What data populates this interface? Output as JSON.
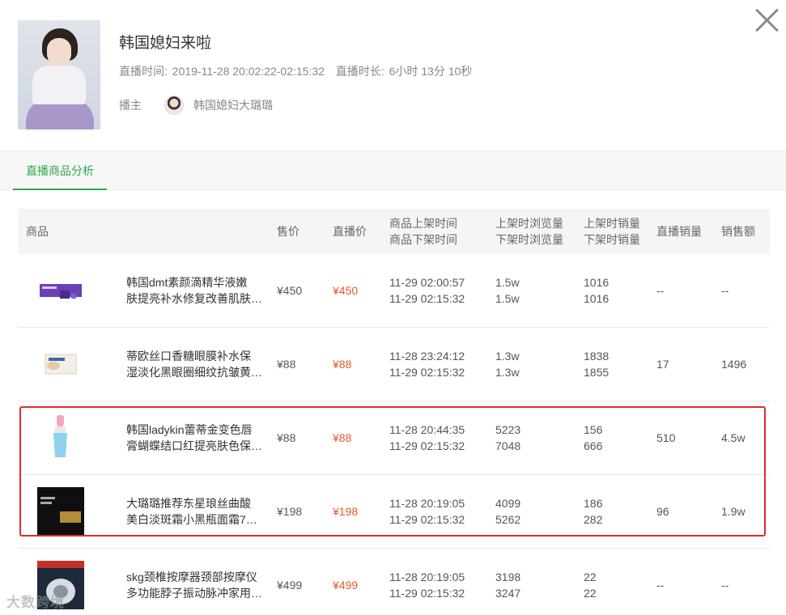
{
  "header": {
    "title": "韩国媳妇来啦",
    "live_time_label": "直播时间:",
    "live_time_value": "2019-11-28 20:02:22-02:15:32",
    "duration_label": "直播时长:",
    "duration_value": "6小时 13分 10秒",
    "anchor_label": "播主",
    "anchor_name": "韩国媳妇大璐璐"
  },
  "tabs": [
    {
      "label": "直播商品分析"
    }
  ],
  "table": {
    "headers": {
      "product": "商品",
      "price": "售价",
      "live_price": "直播价",
      "shelf_on": "商品上架时间",
      "shelf_off": "商品下架时间",
      "views_on": "上架时浏览量",
      "views_off": "下架时浏览量",
      "sales_on": "上架时销量",
      "sales_off": "下架时销量",
      "live_sales": "直播销量",
      "revenue": "销售额"
    },
    "rows": [
      {
        "name1": "韩国dmt素颜滴精华液嫩",
        "name2": "肤提亮补水修复改善肌肤…",
        "price": "¥450",
        "live_price": "¥450",
        "on_time": "11-29 02:00:57",
        "off_time": "11-29 02:15:32",
        "views_on": "1.5w",
        "views_off": "1.5w",
        "sales_on": "1016",
        "sales_off": "1016",
        "live_sales": "--",
        "revenue": "--"
      },
      {
        "name1": "蒂欧丝口香糖眼膜补水保",
        "name2": "湿淡化黑眼圈细纹抗皱黄…",
        "price": "¥88",
        "live_price": "¥88",
        "on_time": "11-28 23:24:12",
        "off_time": "11-29 02:15:32",
        "views_on": "1.3w",
        "views_off": "1.3w",
        "sales_on": "1838",
        "sales_off": "1855",
        "live_sales": "17",
        "revenue": "1496"
      },
      {
        "name1": "韩国ladykin蕾蒂金变色唇",
        "name2": "膏蝴蝶结口红提亮肤色保…",
        "price": "¥88",
        "live_price": "¥88",
        "on_time": "11-28 20:44:35",
        "off_time": "11-29 02:15:32",
        "views_on": "5223",
        "views_off": "7048",
        "sales_on": "156",
        "sales_off": "666",
        "live_sales": "510",
        "revenue": "4.5w"
      },
      {
        "name1": "大璐璐推荐东星琅丝曲酸",
        "name2": "美白淡斑霜小黑瓶面霜7…",
        "price": "¥198",
        "live_price": "¥198",
        "on_time": "11-28 20:19:05",
        "off_time": "11-29 02:15:32",
        "views_on": "4099",
        "views_off": "5262",
        "sales_on": "186",
        "sales_off": "282",
        "live_sales": "96",
        "revenue": "1.9w"
      },
      {
        "name1": "skg颈椎按摩器颈部按摩仪",
        "name2": "多功能脖子振动脉冲家用…",
        "price": "¥499",
        "live_price": "¥499",
        "on_time": "11-28 20:19:05",
        "off_time": "11-29 02:15:32",
        "views_on": "3198",
        "views_off": "3247",
        "sales_on": "22",
        "sales_off": "22",
        "live_sales": "--",
        "revenue": "--"
      }
    ]
  },
  "watermark": "大数跨境",
  "colors": {
    "accent_green": "#2da84b",
    "price_red": "#e8572a",
    "highlight_red": "#e02c2c"
  },
  "icons": {
    "close": "close-icon"
  }
}
